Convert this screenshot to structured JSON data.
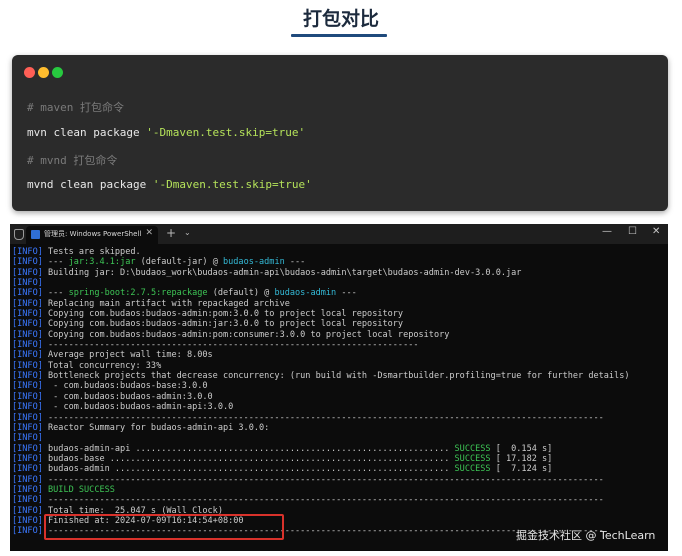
{
  "page": {
    "title": "打包对比"
  },
  "code_block": {
    "lines": [
      {
        "comment": "# maven 打包命令"
      },
      {
        "cmd": "mvn clean package ",
        "arg": "'-Dmaven.test.skip=true'"
      },
      {
        "comment": "# mvnd 打包命令"
      },
      {
        "cmd": "mvnd clean package ",
        "arg": "'-Dmaven.test.skip=true'"
      }
    ]
  },
  "terminal": {
    "tab_label": "管理员: Windows PowerShell",
    "tab_close": "✕",
    "new_tab": "+",
    "dropdown": "⌄",
    "minimize": "—",
    "maximize": "☐",
    "close": "✕",
    "level": "[INFO]",
    "lines": [
      {
        "text": " Tests are skipped."
      },
      {
        "parts": [
          {
            "t": " --- "
          },
          {
            "t": "jar:3.4.1:jar",
            "c": "gr"
          },
          {
            "t": " (default-jar) @ "
          },
          {
            "t": "budaos-admin",
            "c": "cy"
          },
          {
            "t": " ---"
          }
        ]
      },
      {
        "text": " Building jar: D:\\budaos_work\\budaos-admin-api\\budaos-admin\\target\\budaos-admin-dev-3.0.0.jar"
      },
      {
        "text": ""
      },
      {
        "parts": [
          {
            "t": " --- "
          },
          {
            "t": "spring-boot:2.7.5:repackage",
            "c": "gr"
          },
          {
            "t": " (default) @ "
          },
          {
            "t": "budaos-admin",
            "c": "cy"
          },
          {
            "t": " ---"
          }
        ]
      },
      {
        "text": " Replacing main artifact with repackaged archive"
      },
      {
        "text": " Copying com.budaos:budaos-admin:pom:3.0.0 to project local repository"
      },
      {
        "text": " Copying com.budaos:budaos-admin:jar:3.0.0 to project local repository"
      },
      {
        "text": " Copying com.budaos:budaos-admin:pom:consumer:3.0.0 to project local repository"
      },
      {
        "text": " ------------------------------------------------------------------------"
      },
      {
        "text": " Average project wall time: 8.00s"
      },
      {
        "text": " Total concurrency: 33%"
      },
      {
        "text": " Bottleneck projects that decrease concurrency: (run build with -Dsmartbuilder.profiling=true for further details)"
      },
      {
        "text": "  - com.budaos:budaos-base:3.0.0"
      },
      {
        "text": "  - com.budaos:budaos-admin:3.0.0"
      },
      {
        "text": "  - com.budaos:budaos-admin-api:3.0.0"
      },
      {
        "text": " ------------------------------------------------------------------------------------------------------------"
      },
      {
        "text": " Reactor Summary for budaos-admin-api 3.0.0:"
      },
      {
        "text": ""
      },
      {
        "parts": [
          {
            "t": " budaos-admin-api ............................................................. "
          },
          {
            "t": "SUCCESS",
            "c": "gr"
          },
          {
            "t": " [  0.154 s]"
          }
        ]
      },
      {
        "parts": [
          {
            "t": " budaos-base .................................................................. "
          },
          {
            "t": "SUCCESS",
            "c": "gr"
          },
          {
            "t": " [ 17.182 s]"
          }
        ]
      },
      {
        "parts": [
          {
            "t": " budaos-admin ................................................................. "
          },
          {
            "t": "SUCCESS",
            "c": "gr"
          },
          {
            "t": " [  7.124 s]"
          }
        ]
      },
      {
        "text": " ------------------------------------------------------------------------------------------------------------"
      },
      {
        "parts": [
          {
            "t": " BUILD SUCCESS",
            "c": "gr"
          }
        ]
      },
      {
        "text": " ------------------------------------------------------------------------------------------------------------"
      },
      {
        "text": " Total time:  25.047 s (Wall Clock)"
      },
      {
        "text": " Finished at: 2024-07-09T16:14:54+08:00"
      },
      {
        "text": " ------------------------------------------------------------------------------------------------------------"
      }
    ]
  },
  "watermark": "掘金技术社区 @ TechLearn"
}
